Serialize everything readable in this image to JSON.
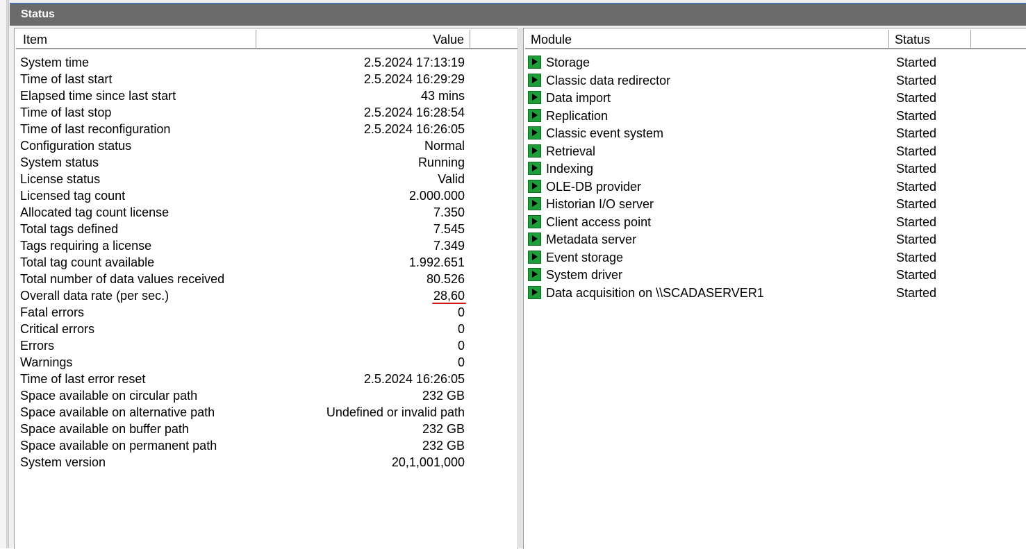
{
  "window": {
    "title": "Status"
  },
  "left_table": {
    "columns": {
      "item": "Item",
      "value": "Value"
    },
    "rows": [
      {
        "item": "System time",
        "value": "2.5.2024 17:13:19"
      },
      {
        "item": "Time of last start",
        "value": "2.5.2024 16:29:29"
      },
      {
        "item": "Elapsed time since last start",
        "value": "43 mins"
      },
      {
        "item": "Time of last stop",
        "value": "2.5.2024 16:28:54"
      },
      {
        "item": "Time of last reconfiguration",
        "value": "2.5.2024 16:26:05"
      },
      {
        "item": "Configuration status",
        "value": "Normal"
      },
      {
        "item": "System status",
        "value": "Running"
      },
      {
        "item": "License status",
        "value": "Valid"
      },
      {
        "item": "Licensed tag count",
        "value": "2.000.000"
      },
      {
        "item": "Allocated tag count license",
        "value": "7.350"
      },
      {
        "item": "Total tags defined",
        "value": "7.545"
      },
      {
        "item": "Tags requiring a license",
        "value": "7.349"
      },
      {
        "item": "Total tag count available",
        "value": "1.992.651"
      },
      {
        "item": "Total number of data values received",
        "value": "80.526"
      },
      {
        "item": "Overall data rate (per sec.)",
        "value": "28,60"
      },
      {
        "item": "Fatal errors",
        "value": "0"
      },
      {
        "item": "Critical errors",
        "value": "0"
      },
      {
        "item": "Errors",
        "value": "0"
      },
      {
        "item": "Warnings",
        "value": "0"
      },
      {
        "item": "Time of last error reset",
        "value": "2.5.2024 16:26:05"
      },
      {
        "item": "Space available on circular path",
        "value": "232 GB"
      },
      {
        "item": "Space available on alternative path",
        "value": "Undefined or invalid path"
      },
      {
        "item": "Space available on buffer path",
        "value": "232 GB"
      },
      {
        "item": "Space available on permanent path",
        "value": "232 GB"
      },
      {
        "item": "System version",
        "value": "20,1,001,000"
      }
    ]
  },
  "right_table": {
    "columns": {
      "module": "Module",
      "status": "Status"
    },
    "rows": [
      {
        "module": "Storage",
        "status": "Started",
        "icon": "play-icon"
      },
      {
        "module": "Classic data redirector",
        "status": "Started",
        "icon": "play-icon"
      },
      {
        "module": "Data import",
        "status": "Started",
        "icon": "play-icon"
      },
      {
        "module": "Replication",
        "status": "Started",
        "icon": "play-icon"
      },
      {
        "module": "Classic event system",
        "status": "Started",
        "icon": "play-icon"
      },
      {
        "module": "Retrieval",
        "status": "Started",
        "icon": "play-icon"
      },
      {
        "module": "Indexing",
        "status": "Started",
        "icon": "play-icon"
      },
      {
        "module": "OLE-DB provider",
        "status": "Started",
        "icon": "play-icon"
      },
      {
        "module": "Historian I/O server",
        "status": "Started",
        "icon": "play-icon"
      },
      {
        "module": "Client access point",
        "status": "Started",
        "icon": "play-icon"
      },
      {
        "module": "Metadata server",
        "status": "Started",
        "icon": "play-icon"
      },
      {
        "module": "Event storage",
        "status": "Started",
        "icon": "play-icon"
      },
      {
        "module": "System driver",
        "status": "Started",
        "icon": "play-icon"
      },
      {
        "module": "Data acquisition on \\\\SCADASERVER1",
        "status": "Started",
        "icon": "play-icon"
      }
    ]
  },
  "colors": {
    "title_bar": "#6b6b6b",
    "started_icon": "#1e9e3a",
    "highlight_underline": "#d01818"
  }
}
